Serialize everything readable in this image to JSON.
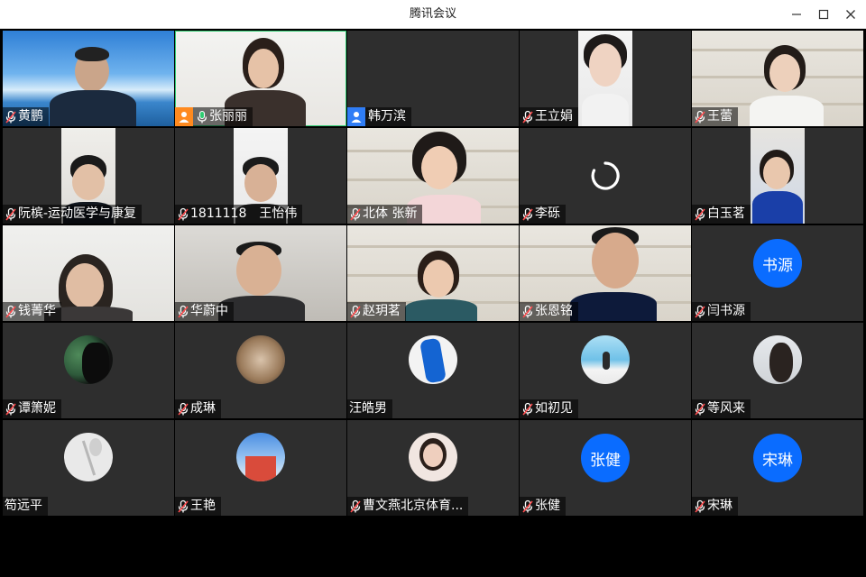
{
  "window": {
    "title": "腾讯会议"
  },
  "colors": {
    "accent": "#0a6cff",
    "speaking": "#2ecc71",
    "host": "#ff8a1f",
    "guest": "#2f7df6",
    "muted": "#ff4d4f"
  },
  "tiles": [
    {
      "name": "黄鹏",
      "mic": "mic-muted-icon"
    },
    {
      "name": "张丽丽",
      "mic": "mic-active-icon",
      "badge": "host-user-icon",
      "speaking": true
    },
    {
      "name": "韩万滨",
      "badge": "user-icon"
    },
    {
      "name": "王立娟",
      "mic": "mic-muted-icon"
    },
    {
      "name": "王蕾",
      "mic": "mic-muted-icon"
    },
    {
      "name": "阮槟-运动医学与康复",
      "mic": "mic-muted-icon"
    },
    {
      "name": "1811118　王怡伟",
      "mic": "mic-muted-icon"
    },
    {
      "name": "北体 张新",
      "mic": "mic-muted-icon"
    },
    {
      "name": "李砾",
      "mic": "mic-muted-icon",
      "loading": true
    },
    {
      "name": "白玉茗",
      "mic": "mic-muted-icon"
    },
    {
      "name": "钱菁华",
      "mic": "mic-muted-icon"
    },
    {
      "name": "华蔚中",
      "mic": "mic-muted-icon"
    },
    {
      "name": "赵玥茗",
      "mic": "mic-muted-icon"
    },
    {
      "name": "张恩铭",
      "mic": "mic-muted-icon"
    },
    {
      "name": "闫书源",
      "mic": "mic-muted-icon",
      "avatar_text": "书源"
    },
    {
      "name": "谭箫妮",
      "mic": "mic-muted-icon"
    },
    {
      "name": "成琳",
      "mic": "mic-muted-icon"
    },
    {
      "name": "汪皓男"
    },
    {
      "name": "如初见",
      "mic": "mic-muted-icon"
    },
    {
      "name": "等风来",
      "mic": "mic-muted-icon"
    },
    {
      "name": "笱远平"
    },
    {
      "name": "王艳",
      "mic": "mic-muted-icon"
    },
    {
      "name": "曹文燕北京体育...",
      "mic": "mic-muted-icon"
    },
    {
      "name": "张健",
      "mic": "mic-muted-icon",
      "avatar_text": "张健"
    },
    {
      "name": "宋琳",
      "mic": "mic-muted-icon",
      "avatar_text": "宋琳"
    }
  ]
}
